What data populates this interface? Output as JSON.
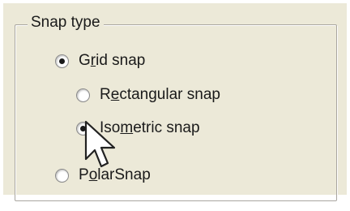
{
  "group": {
    "title": "Snap type"
  },
  "options": {
    "grid": {
      "pre": "G",
      "accel": "r",
      "post": "id snap",
      "checked": true
    },
    "rectangular": {
      "pre": "R",
      "accel": "e",
      "post": "ctangular snap",
      "checked": false
    },
    "isometric": {
      "pre": "Iso",
      "accel": "m",
      "post": "etric snap",
      "checked": true
    },
    "polar": {
      "pre": "P",
      "accel": "o",
      "post": "larSnap",
      "checked": false
    }
  },
  "colors": {
    "panel": "#ece9d8",
    "text": "#1a1a1a"
  },
  "icons": {
    "cursor": "mouse-pointer-arrow-icon"
  }
}
